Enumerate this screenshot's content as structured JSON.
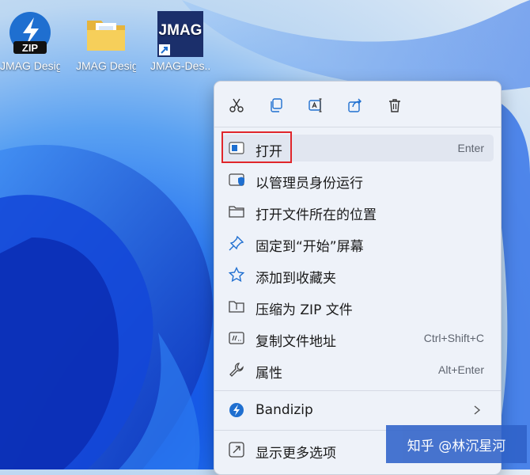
{
  "desktop": {
    "icons": [
      {
        "label": "JMAG Design...",
        "icon": "zip-archive-icon",
        "badge": "ZIP"
      },
      {
        "label": "JMAG Design...",
        "icon": "folder-icon"
      },
      {
        "label": "JMAG-Des...",
        "icon": "jmag-logo-icon",
        "logo_text": "JMAG"
      }
    ]
  },
  "context_menu": {
    "toolbar": [
      {
        "name": "cut",
        "icon": "scissors-icon"
      },
      {
        "name": "copy",
        "icon": "copy-icon"
      },
      {
        "name": "rename",
        "icon": "rename-icon"
      },
      {
        "name": "share",
        "icon": "share-icon"
      },
      {
        "name": "delete",
        "icon": "trash-icon"
      }
    ],
    "items": [
      {
        "label": "打开",
        "shortcut": "Enter",
        "icon": "open-window-icon"
      },
      {
        "label": "以管理员身份运行",
        "shortcut": "",
        "icon": "shield-icon"
      },
      {
        "label": "打开文件所在的位置",
        "shortcut": "",
        "icon": "folder-outline-icon"
      },
      {
        "label": "固定到“开始”屏幕",
        "shortcut": "",
        "icon": "pin-icon"
      },
      {
        "label": "添加到收藏夹",
        "shortcut": "",
        "icon": "star-icon"
      },
      {
        "label": "压缩为 ZIP 文件",
        "shortcut": "",
        "icon": "zip-folder-icon"
      },
      {
        "label": "复制文件地址",
        "shortcut": "Ctrl+Shift+C",
        "icon": "copy-path-icon"
      },
      {
        "label": "属性",
        "shortcut": "Alt+Enter",
        "icon": "wrench-icon"
      },
      {
        "label": "Bandizip",
        "shortcut": "",
        "icon": "bandizip-icon"
      },
      {
        "label": "显示更多选项",
        "shortcut": "",
        "icon": "more-options-icon"
      }
    ]
  },
  "watermark": {
    "text": "知乎 @林沉星河"
  },
  "colors": {
    "accent": "#1f6fd0",
    "highlight_box": "#e0262b"
  }
}
